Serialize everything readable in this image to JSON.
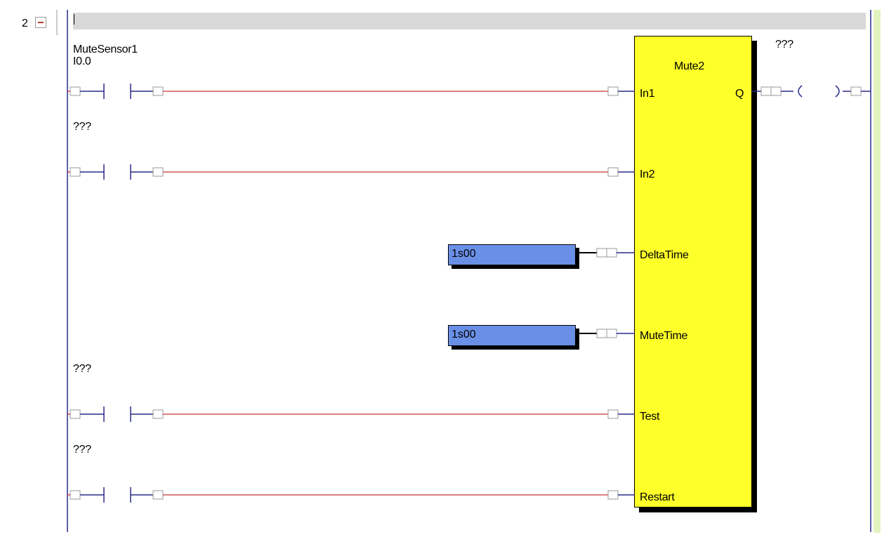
{
  "rung": {
    "number": "2"
  },
  "block": {
    "name": "Mute2",
    "output_var": "???"
  },
  "inputs": [
    {
      "pin": "In1",
      "var_name": "MuteSensor1",
      "var_addr": "I0.0"
    },
    {
      "pin": "In2",
      "var_name": "???",
      "var_addr": ""
    },
    {
      "pin": "DeltaTime",
      "value": "1s00"
    },
    {
      "pin": "MuteTime",
      "value": "1s00"
    },
    {
      "pin": "Test",
      "var_name": "???",
      "var_addr": ""
    },
    {
      "pin": "Restart",
      "var_name": "???",
      "var_addr": ""
    }
  ],
  "output": {
    "pin": "Q"
  },
  "colors": {
    "wire": "#cc3333",
    "rail": "#2a2a8a",
    "block": "#ffff2a",
    "constant": "#6a8fe6",
    "comment_bar": "#d9d9d9"
  }
}
